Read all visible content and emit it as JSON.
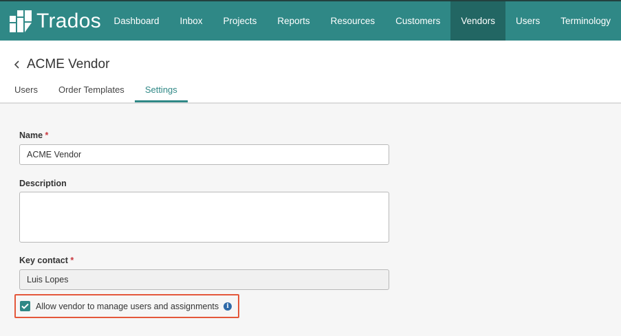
{
  "app": {
    "name": "Trados"
  },
  "nav": {
    "items": [
      {
        "label": "Dashboard"
      },
      {
        "label": "Inbox"
      },
      {
        "label": "Projects"
      },
      {
        "label": "Reports"
      },
      {
        "label": "Resources"
      },
      {
        "label": "Customers"
      },
      {
        "label": "Vendors",
        "active": true
      },
      {
        "label": "Users"
      },
      {
        "label": "Terminology"
      }
    ]
  },
  "page": {
    "title": "ACME Vendor"
  },
  "tabs": [
    {
      "label": "Users"
    },
    {
      "label": "Order Templates"
    },
    {
      "label": "Settings",
      "active": true
    }
  ],
  "form": {
    "name": {
      "label": "Name",
      "required": "*",
      "value": "ACME Vendor"
    },
    "description": {
      "label": "Description",
      "value": ""
    },
    "key_contact": {
      "label": "Key contact",
      "required": "*",
      "value": "Luis Lopes"
    },
    "allow_manage": {
      "label": "Allow vendor to manage users and assignments",
      "checked": true
    }
  },
  "colors": {
    "brand": "#2f8886",
    "nav_active": "#226663",
    "required": "#c8373e",
    "highlight": "#e4573a",
    "info": "#2f6aa8"
  }
}
